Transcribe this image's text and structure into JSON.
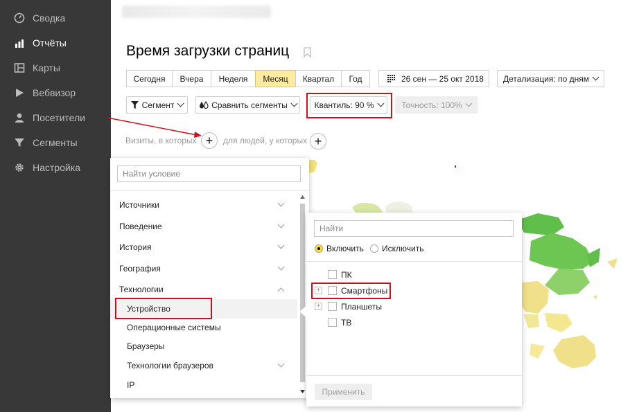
{
  "sidebar": {
    "items": [
      {
        "label": "Сводка",
        "icon": "dashboard-gauge-icon"
      },
      {
        "label": "Отчёты",
        "icon": "bar-chart-icon",
        "active": true
      },
      {
        "label": "Карты",
        "icon": "map-icon"
      },
      {
        "label": "Вебвизор",
        "icon": "play-icon"
      },
      {
        "label": "Посетители",
        "icon": "person-icon"
      },
      {
        "label": "Сегменты",
        "icon": "funnel-icon"
      },
      {
        "label": "Настройка",
        "icon": "gear-icon"
      }
    ]
  },
  "header": {
    "title": "Время загрузки страниц"
  },
  "period": {
    "options": [
      "Сегодня",
      "Вчера",
      "Неделя",
      "Месяц",
      "Квартал",
      "Год"
    ],
    "selected": "Месяц",
    "date_range": "26 сен — 25 окт 2018",
    "detail": "Детализация: по дням"
  },
  "toolbar": {
    "segment": "Сегмент",
    "compare": "Сравнить сегменты",
    "quantile": "Квантиль: 90 %",
    "accuracy": "Точность: 100%"
  },
  "filter": {
    "visits_text": "Визиты, в которых",
    "people_text": "для людей, у которых"
  },
  "condition_panel": {
    "search_placeholder": "Найти условие",
    "groups": [
      "Источники",
      "Поведение",
      "История",
      "География",
      "Технологии"
    ],
    "tech_items": [
      "Устройство",
      "Операционные системы",
      "Браузеры",
      "Технологии браузеров",
      "IP"
    ]
  },
  "device_panel": {
    "search_placeholder": "Найти",
    "include": "Включить",
    "exclude": "Исключить",
    "options": [
      "ПК",
      "Смартфоны",
      "Планшеты",
      "ТВ"
    ],
    "apply": "Применить"
  },
  "colors": {
    "sidebar_bg": "#383838",
    "selected_bg": "#ffeba0",
    "highlight_red": "#d0111b",
    "map_green": "#5fbf4a",
    "map_yellow": "#f0e08a"
  }
}
